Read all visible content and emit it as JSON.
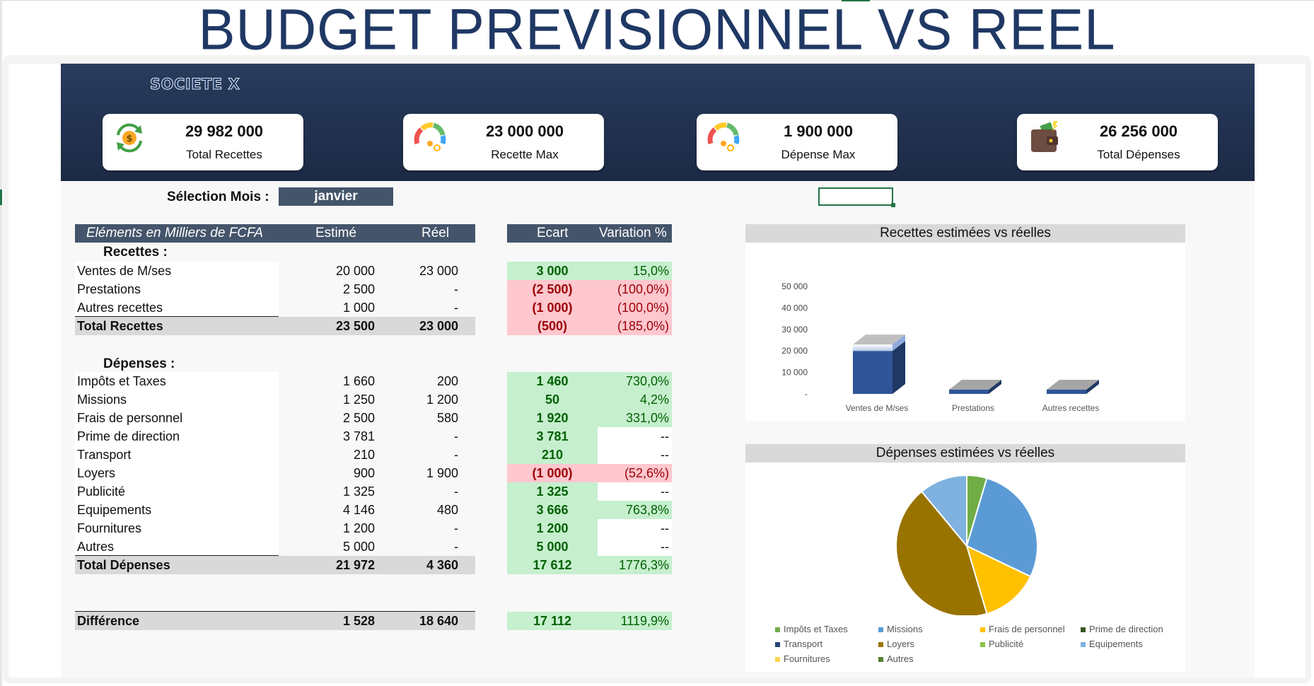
{
  "title": "BUDGET PREVISIONNEL VS REEL",
  "company": "SOCIETE X",
  "kpis": [
    {
      "value": "29 982 000",
      "label": "Total Recettes",
      "icon": "money-cycle-icon"
    },
    {
      "value": "23 000 000",
      "label": "Recette Max",
      "icon": "gauge-icon"
    },
    {
      "value": "1 900 000",
      "label": "Dépense Max",
      "icon": "gauge-icon"
    },
    {
      "value": "26 256 000",
      "label": "Total Dépenses",
      "icon": "wallet-icon"
    }
  ],
  "selection": {
    "label": "Sélection Mois :",
    "value": "janvier"
  },
  "table": {
    "headers": {
      "elements": "Eléments en Milliers de FCFA",
      "estime": "Estimé",
      "reel": "Réel",
      "ecart": "Ecart",
      "variation": "Variation %"
    },
    "recettes_label": "Recettes :",
    "recettes": [
      {
        "name": "Ventes de M/ses",
        "estime": "20 000",
        "reel": "23 000",
        "ecart": "3 000",
        "variation": "15,0%",
        "status": "pos",
        "var_status": "pos"
      },
      {
        "name": "Prestations",
        "estime": "2 500",
        "reel": "-",
        "ecart": "(2 500)",
        "variation": "(100,0%)",
        "status": "neg",
        "var_status": "neg"
      },
      {
        "name": "Autres recettes",
        "estime": "1 000",
        "reel": "-",
        "ecart": "(1 000)",
        "variation": "(100,0%)",
        "status": "neg",
        "var_status": "neg"
      }
    ],
    "total_recettes": {
      "name": "Total Recettes",
      "estime": "23 500",
      "reel": "23 000",
      "ecart": "(500)",
      "variation": "(185,0%)",
      "status": "neg"
    },
    "depenses_label": "Dépenses :",
    "depenses": [
      {
        "name": "Impôts et Taxes",
        "estime": "1 660",
        "reel": "200",
        "ecart": "1 460",
        "variation": "730,0%",
        "status": "pos",
        "var_status": "pos"
      },
      {
        "name": "Missions",
        "estime": "1 250",
        "reel": "1 200",
        "ecart": "50",
        "variation": "4,2%",
        "status": "pos",
        "var_status": "pos"
      },
      {
        "name": "Frais de personnel",
        "estime": "2 500",
        "reel": "580",
        "ecart": "1 920",
        "variation": "331,0%",
        "status": "pos",
        "var_status": "pos"
      },
      {
        "name": "Prime de direction",
        "estime": "3 781",
        "reel": "-",
        "ecart": "3 781",
        "variation": "--",
        "status": "pos",
        "var_status": "none"
      },
      {
        "name": "Transport",
        "estime": "210",
        "reel": "-",
        "ecart": "210",
        "variation": "--",
        "status": "pos",
        "var_status": "none"
      },
      {
        "name": "Loyers",
        "estime": "900",
        "reel": "1 900",
        "ecart": "(1 000)",
        "variation": "(52,6%)",
        "status": "neg",
        "var_status": "neg"
      },
      {
        "name": "Publicité",
        "estime": "1 325",
        "reel": "-",
        "ecart": "1 325",
        "variation": "--",
        "status": "pos",
        "var_status": "none"
      },
      {
        "name": "Equipements",
        "estime": "4 146",
        "reel": "480",
        "ecart": "3 666",
        "variation": "763,8%",
        "status": "pos",
        "var_status": "pos"
      },
      {
        "name": "Fournitures",
        "estime": "1 200",
        "reel": "-",
        "ecart": "1 200",
        "variation": "--",
        "status": "pos",
        "var_status": "none"
      },
      {
        "name": "Autres",
        "estime": "5 000",
        "reel": "-",
        "ecart": "5 000",
        "variation": "--",
        "status": "pos",
        "var_status": "none"
      }
    ],
    "total_depenses": {
      "name": "Total Dépenses",
      "estime": "21 972",
      "reel": "4 360",
      "ecart": "17 612",
      "variation": "1776,3%",
      "status": "pos"
    },
    "difference": {
      "name": "Différence",
      "estime": "1 528",
      "reel": "18 640",
      "ecart": "17 112",
      "variation": "1119,9%",
      "status": "pos"
    }
  },
  "chart_data": [
    {
      "type": "bar",
      "title": "Recettes estimées vs réelles",
      "categories": [
        "Ventes de M/ses",
        "Prestations",
        "Autres recettes"
      ],
      "series": [
        {
          "values": [
            20000,
            2500,
            1000
          ],
          "color": "#2f5597"
        },
        {
          "values": [
            23000,
            0,
            0
          ],
          "color": "#dae3f3"
        }
      ],
      "ylim": [
        0,
        50000
      ],
      "yticks": [
        "50 000",
        "40 000",
        "30 000",
        "20 000",
        "10 000",
        "-"
      ],
      "ytick_values": [
        50000,
        40000,
        30000,
        20000,
        10000,
        0
      ]
    },
    {
      "type": "pie",
      "title": "Dépenses estimées vs réelles",
      "labels": [
        "Impôts et Taxes",
        "Missions",
        "Frais de personnel",
        "Prime de direction",
        "Transport",
        "Loyers",
        "Publicité",
        "Equipements",
        "Fournitures",
        "Autres"
      ],
      "values": [
        200,
        1200,
        580,
        0,
        0,
        1900,
        0,
        480,
        0,
        0
      ],
      "colors": [
        "#70ad47",
        "#5b9bd5",
        "#ffc000",
        "#375623",
        "#264478",
        "#997300",
        "#8bc34a",
        "#7fb2e0",
        "#ffd34e",
        "#548235"
      ]
    }
  ]
}
